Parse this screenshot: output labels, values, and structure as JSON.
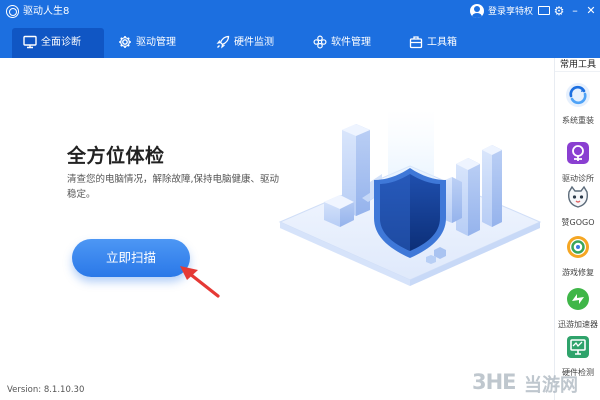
{
  "titlebar": {
    "app_title": "驱动人生8",
    "login_text": "登录享特权",
    "minimize_label": "–",
    "close_label": "✕",
    "gear_label": "⚙"
  },
  "nav": {
    "tabs": [
      {
        "label": "全面诊断",
        "icon": "monitor-icon",
        "active": true
      },
      {
        "label": "驱动管理",
        "icon": "gear-icon"
      },
      {
        "label": "硬件监测",
        "icon": "rocket-icon"
      },
      {
        "label": "软件管理",
        "icon": "flower-icon"
      },
      {
        "label": "工具箱",
        "icon": "toolbox-icon"
      }
    ]
  },
  "main": {
    "headline": "全方位体检",
    "description": "清查您的电脑情况，解除故障,保持电脑健康、驱动稳定。",
    "scan_button": "立即扫描"
  },
  "footer": {
    "version": "Version:  8.1.10.30"
  },
  "tools": {
    "title": "常用工具",
    "items": [
      {
        "label": "系统重装",
        "icon": "system-reinstall-icon"
      },
      {
        "label": "驱动诊所",
        "icon": "driver-clinic-icon"
      },
      {
        "label": "赞GOGO",
        "icon": "zan-gogo-icon"
      },
      {
        "label": "游戏修复",
        "icon": "game-repair-icon"
      },
      {
        "label": "迅游加速器",
        "icon": "xunyou-accelerator-icon"
      },
      {
        "label": "硬件检测",
        "icon": "hardware-check-icon"
      }
    ]
  },
  "watermark": {
    "logo": "3HE",
    "text": "当游网"
  },
  "colors": {
    "brand_blue": "#1c6fe0",
    "active_tab": "#1056c4",
    "button_blue": "#2a78e8",
    "arrow_red": "#e53935"
  }
}
